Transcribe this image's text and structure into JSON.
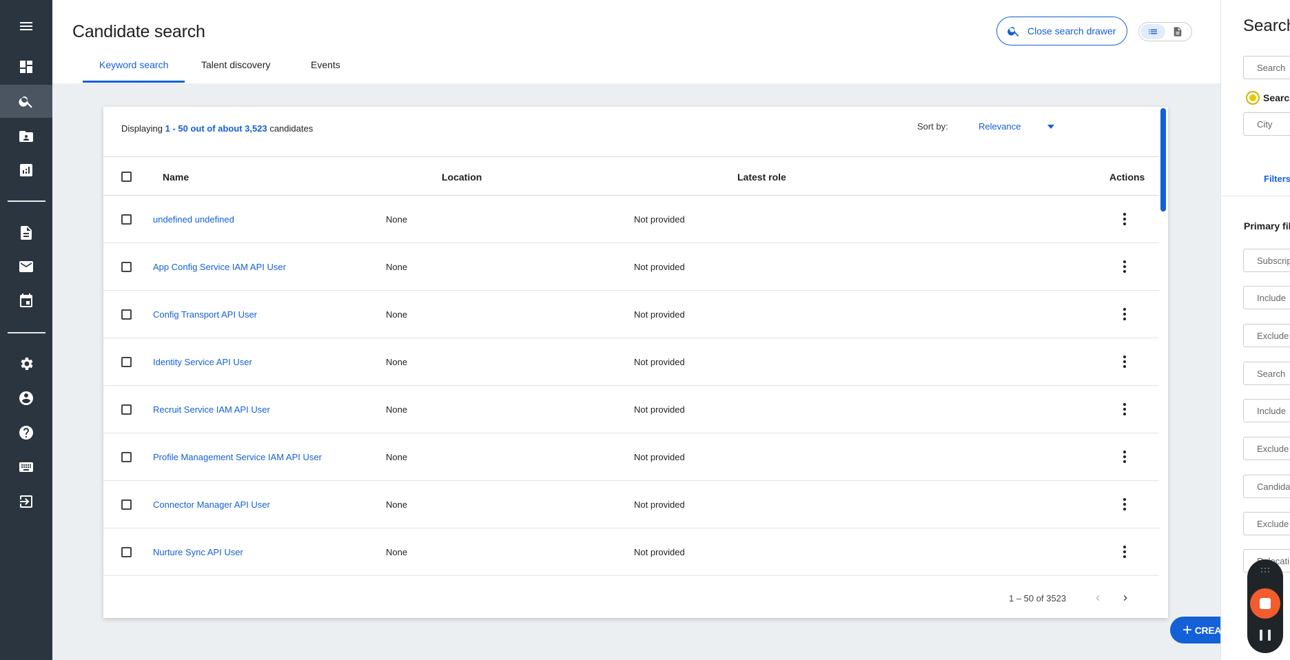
{
  "header": {
    "title": "Candidate search",
    "tabs": [
      {
        "label": "Keyword search",
        "active": true
      },
      {
        "label": "Talent discovery",
        "active": false
      },
      {
        "label": "Events",
        "active": false
      }
    ],
    "close_drawer_label": "Close search drawer"
  },
  "results": {
    "summary_prefix": "Displaying",
    "summary_range": "1 - 50 out of about 3,523",
    "summary_suffix": "candidates",
    "sort_label": "Sort by:",
    "sort_value": "Relevance",
    "columns": {
      "name": "Name",
      "location": "Location",
      "latest_role": "Latest role",
      "actions": "Actions"
    },
    "rows": [
      {
        "name": "undefined undefined",
        "location": "None",
        "latest_role": "Not provided"
      },
      {
        "name": "App Config Service IAM API User",
        "location": "None",
        "latest_role": "Not provided"
      },
      {
        "name": "Config Transport API User",
        "location": "None",
        "latest_role": "Not provided"
      },
      {
        "name": "Identity Service API User",
        "location": "None",
        "latest_role": "Not provided"
      },
      {
        "name": "Recruit Service IAM API User",
        "location": "None",
        "latest_role": "Not provided"
      },
      {
        "name": "Profile Management Service IAM API User",
        "location": "None",
        "latest_role": "Not provided"
      },
      {
        "name": "Connector Manager API User",
        "location": "None",
        "latest_role": "Not provided"
      },
      {
        "name": "Nurture Sync API User",
        "location": "None",
        "latest_role": "Not provided"
      }
    ],
    "pagination": "1 – 50 of 3523"
  },
  "create_button_label": "CREATE CANDID",
  "drawer": {
    "title": "Search",
    "search_placeholder": "Search",
    "radio_label": "Search",
    "city_placeholder": "City",
    "filters_tab": "Filters",
    "section_title": "Primary fil",
    "fields": [
      "Subscrip",
      "Include",
      "Exclude",
      "Search",
      "Include",
      "Exclude",
      "Candida",
      "Exclude",
      "Relocati"
    ]
  },
  "colors": {
    "accent": "#1460d6",
    "sidebar": "#2b3540",
    "recorder_stop": "#f25c2e"
  },
  "icons": {
    "sidebar": [
      "menu-icon",
      "dashboard-icon",
      "search-icon",
      "contacts-icon",
      "analytics-icon",
      "document-icon",
      "mail-icon",
      "calendar-icon",
      "settings-icon",
      "account-icon",
      "help-icon",
      "keyboard-icon",
      "logout-icon"
    ]
  }
}
